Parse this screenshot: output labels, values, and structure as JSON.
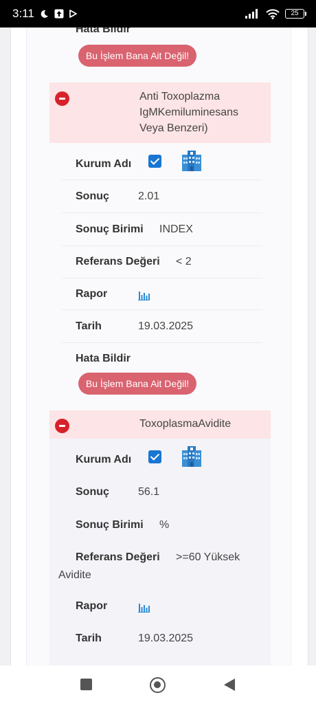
{
  "status_bar": {
    "time": "3:11",
    "icons": [
      "moon-icon",
      "upload-icon",
      "play-icon"
    ],
    "right_icons": [
      "signal-icon",
      "wifi-icon"
    ],
    "battery": "25"
  },
  "top_partial": {
    "hata_label": "Hata Bildir",
    "report_button": "Bu İşlem Bana Ait Değil!"
  },
  "section1": {
    "title_lines": [
      "Anti Toxoplazma",
      "IgMKemiluminesans",
      "Veya Benzeri)"
    ],
    "kurum_label": "Kurum Adı",
    "kurum_checked": true,
    "sonuc_label": "Sonuç",
    "sonuc_value": "2.01",
    "birim_label": "Sonuç Birimi",
    "birim_value": "INDEX",
    "referans_label": "Referans Değeri",
    "referans_value": "< 2",
    "rapor_label": "Rapor",
    "tarih_label": "Tarih",
    "tarih_value": "19.03.2025",
    "hata_label": "Hata Bildir",
    "report_button": "Bu İşlem Bana Ait Değil!"
  },
  "section2": {
    "title": "ToxoplasmaAvidite",
    "kurum_label": "Kurum Adı",
    "kurum_checked": true,
    "sonuc_label": "Sonuç",
    "sonuc_value": "56.1",
    "birim_label": "Sonuç Birimi",
    "birim_value": "%",
    "referans_label": "Referans Değeri",
    "referans_value": ">=60 Yüksek",
    "referans_value_cont": "Avidite",
    "rapor_label": "Rapor",
    "tarih_label": "Tarih",
    "tarih_value": "19.03.2025"
  },
  "nav_bar": {
    "icons": [
      "recent-apps-icon",
      "home-icon",
      "back-icon"
    ]
  },
  "colors": {
    "accent_blue": "#1976d2",
    "danger_red": "#d8222b",
    "pill_red": "#d9636f",
    "section_header_bg": "#fde4e6"
  }
}
